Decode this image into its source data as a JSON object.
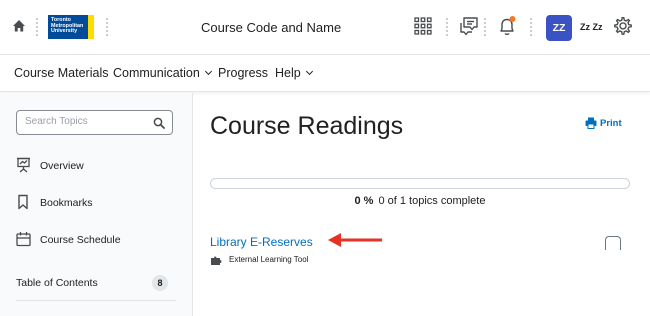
{
  "header": {
    "logo_line1": "Toronto",
    "logo_line2": "Metropolitan",
    "logo_line3": "University",
    "course_title": "Course Code and Name",
    "avatar_initials": "ZZ",
    "username": "Zz Zz",
    "notification_dot_color": "#f47920"
  },
  "nav": {
    "items": [
      {
        "label": "Course Materials",
        "dropdown": false
      },
      {
        "label": "Communication",
        "dropdown": true
      },
      {
        "label": "Progress",
        "dropdown": false
      },
      {
        "label": "Help",
        "dropdown": true
      }
    ]
  },
  "sidebar": {
    "search_placeholder": "Search Topics",
    "items": [
      {
        "label": "Overview",
        "icon": "presentation-icon"
      },
      {
        "label": "Bookmarks",
        "icon": "bookmark-icon"
      },
      {
        "label": "Course Schedule",
        "icon": "calendar-icon"
      }
    ],
    "toc_label": "Table of Contents",
    "toc_count": "8"
  },
  "main": {
    "title": "Course Readings",
    "print_label": "Print",
    "progress": {
      "percent": "0 %",
      "fraction": 0,
      "text": "0 of 1 topics complete"
    },
    "topics": [
      {
        "title": "Library E-Reserves",
        "type": "External Learning Tool",
        "completed": false
      }
    ]
  },
  "colors": {
    "link": "#006fbf",
    "avatar": "#3b52c4",
    "annotation_arrow": "#e53225",
    "logo_blue": "#004c9b",
    "logo_yellow": "#ffdc00"
  }
}
